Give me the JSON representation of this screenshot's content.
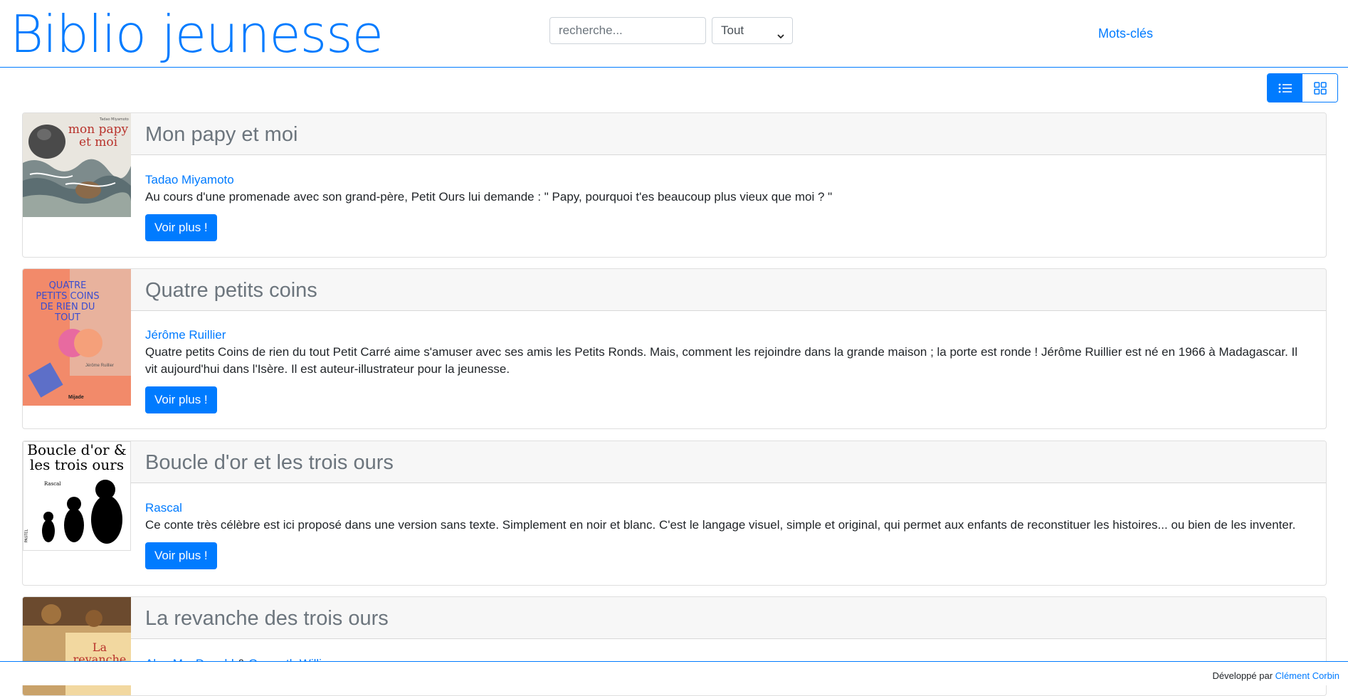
{
  "header": {
    "site_title": "Biblio jeunesse",
    "search_placeholder": "recherche...",
    "filter_selected": "Tout",
    "nav_keywords": "Mots-clés"
  },
  "view_toggle": {
    "list_icon": "list-icon",
    "grid_icon": "grid-icon",
    "active": "list"
  },
  "books": [
    {
      "title": "Mon papy et moi",
      "authors": [
        "Tadao Miyamoto"
      ],
      "description": "Au cours d'une promenade avec son grand-père, Petit Ours lui demande : \" Papy, pourquoi t'es beaucoup plus vieux que moi ? \"",
      "button": "Voir plus !",
      "cover_text": "mon papy et moi",
      "cover_small_text": "Tadao Miyamoto"
    },
    {
      "title": "Quatre petits coins",
      "authors": [
        "Jérôme Ruillier"
      ],
      "description": "Quatre petits Coins de rien du tout Petit Carré aime s'amuser avec ses amis les Petits Ronds. Mais, comment les rejoindre dans la grande maison ; la porte est ronde ! Jérôme Ruillier est né en 1966 à Madagascar. Il vit aujourd'hui dans l'Isère. Il est auteur-illustrateur pour la jeunesse.",
      "button": "Voir plus !",
      "cover_text": "QUATRE PETITS COINS DE RIEN DU TOUT",
      "cover_small_text": "Jérôme Ruillier",
      "cover_publisher": "Mijade"
    },
    {
      "title": "Boucle d'or et les trois ours",
      "authors": [
        "Rascal"
      ],
      "description": "Ce conte très célèbre est ici proposé dans une version sans texte. Simplement en noir et blanc. C'est le langage visuel, simple et original, qui permet aux enfants de reconstituer les histoires... ou bien de les inventer.",
      "button": "Voir plus !",
      "cover_text": "Boucle d'or & les trois ours",
      "cover_small_text": "Rascal",
      "cover_publisher": "PASTEL"
    },
    {
      "title": "La revanche des trois ours",
      "authors": [
        "Alan MacDonald",
        "Gwyneth Williamson"
      ],
      "author_separator": "&",
      "cover_text": "La revanche des"
    }
  ],
  "footer": {
    "prefix": "Développé par",
    "author_link": "Clément Corbin"
  }
}
